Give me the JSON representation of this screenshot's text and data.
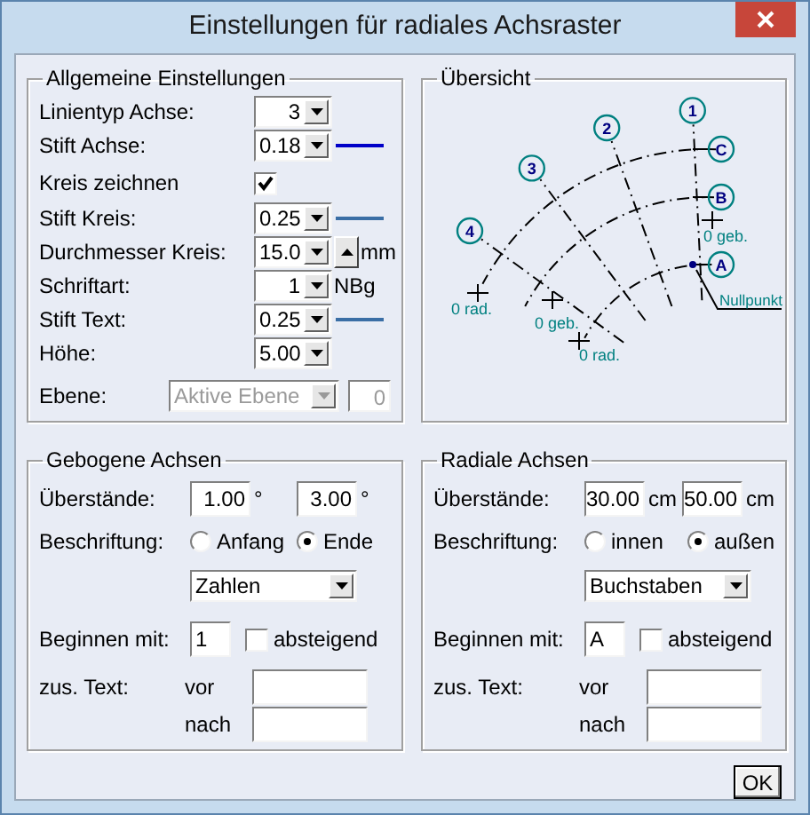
{
  "window": {
    "title": "Einstellungen für radiales Achsraster"
  },
  "general": {
    "legend": "Allgemeine Einstellungen",
    "rows": [
      {
        "kind": "combo",
        "label": "Linientyp Achse:",
        "value": "3"
      },
      {
        "kind": "combo",
        "label": "Stift Achse:",
        "value": "0.18",
        "color": "#0000c8"
      },
      {
        "kind": "checkbox",
        "label": "Kreis zeichnen",
        "checked": true
      },
      {
        "kind": "combo",
        "label": "Stift Kreis:",
        "value": "0.25",
        "color": "#3a6ea5"
      },
      {
        "kind": "spin",
        "label": "Durchmesser Kreis:",
        "value": "15.0",
        "unit": "mm"
      },
      {
        "kind": "combo",
        "label": "Schriftart:",
        "value": "1",
        "unit": "NBg"
      },
      {
        "kind": "combo",
        "label": "Stift Text:",
        "value": "0.25",
        "color": "#3a6ea5"
      },
      {
        "kind": "combo",
        "label": "Höhe:",
        "value": "5.00"
      }
    ],
    "layer": {
      "label": "Ebene:",
      "value": "Aktive Ebene",
      "disabled": true,
      "number": "0"
    }
  },
  "overview": {
    "legend": "Übersicht",
    "radial_labels": [
      "1",
      "2",
      "3",
      "4"
    ],
    "arc_labels": [
      "C",
      "B",
      "A"
    ],
    "annotations": [
      "0 geb.",
      "0 rad.",
      "0 geb.",
      "0 rad."
    ],
    "origin_label": "Nullpunkt"
  },
  "groups": [
    {
      "legend": "Gebogene Achsen",
      "overhang": {
        "label": "Überstände:",
        "values": [
          {
            "value": "1.00",
            "unit": "°"
          },
          {
            "value": "3.00",
            "unit": "°"
          }
        ]
      },
      "labeling": {
        "label": "Beschriftung:",
        "options": [
          {
            "label": "Anfang",
            "selected": false
          },
          {
            "label": "Ende",
            "selected": true
          }
        ]
      },
      "format": "Zahlen",
      "start": {
        "label": "Beginnen mit:",
        "value": "1",
        "descending": {
          "label": "absteigend",
          "checked": false
        }
      },
      "extra": {
        "label": "zus. Text:",
        "fields": [
          {
            "label": "vor"
          },
          {
            "label": "nach"
          }
        ]
      }
    },
    {
      "legend": "Radiale Achsen",
      "overhang": {
        "label": "Überstände:",
        "values": [
          {
            "value": "30.00",
            "unit": "cm"
          },
          {
            "value": "50.00",
            "unit": "cm"
          }
        ]
      },
      "labeling": {
        "label": "Beschriftung:",
        "options": [
          {
            "label": "innen",
            "selected": false
          },
          {
            "label": "außen",
            "selected": true
          }
        ]
      },
      "format": "Buchstaben",
      "start": {
        "label": "Beginnen mit:",
        "value": "A",
        "descending": {
          "label": "absteigend",
          "checked": false
        }
      },
      "extra": {
        "label": "zus. Text:",
        "fields": [
          {
            "label": "vor"
          },
          {
            "label": "nach"
          }
        ]
      }
    }
  ],
  "buttons": [
    {
      "label": "OK"
    }
  ]
}
